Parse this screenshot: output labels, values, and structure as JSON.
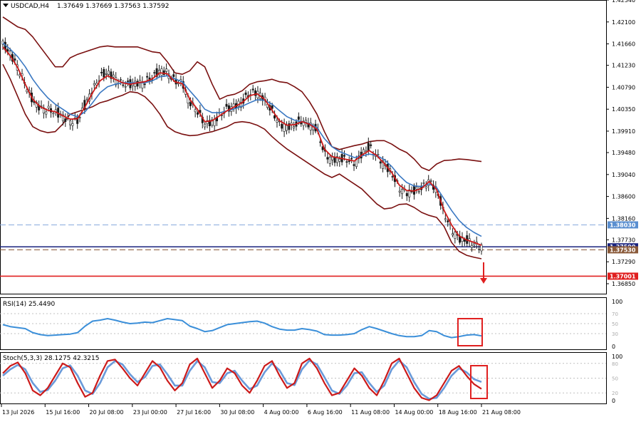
{
  "symbol_label": "USDCAD,H4",
  "ohlc_text": "1.37649 1.37669 1.37563 1.37592",
  "rsi_label": "RSI(14) 25.4490",
  "stoch_label": "Stoch(5,3,3) 28.1275 42.3215",
  "colors": {
    "background": "#ffffff",
    "candle": "#1a1a1a",
    "fast_ma": "#cc1a1a",
    "slow_ma": "#3a78c2",
    "bollinger": "#7a1010",
    "rsi_line": "#3b8fd9",
    "stoch_main": "#cc1a1a",
    "stoch_signal": "#6a9ad9",
    "current_price_line": "#1a237e",
    "support_line": "#e02020",
    "dashed_level_blue": "#88aadd",
    "dashed_level_brown": "#8a5a3a",
    "highlight_box": "#e02020"
  },
  "chart_data": {
    "type": "candlestick",
    "price_axis": {
      "ylim": [
        1.3665,
        1.4254
      ],
      "ticks": [
        "1.42540",
        "1.42100",
        "1.41660",
        "1.41230",
        "1.40790",
        "1.40350",
        "1.39910",
        "1.39480",
        "1.39040",
        "1.38600",
        "1.38160",
        "1.37730",
        "1.37290",
        "1.36850"
      ],
      "tick_values": [
        1.4254,
        1.421,
        1.4166,
        1.4123,
        1.4079,
        1.4035,
        1.3991,
        1.3948,
        1.3904,
        1.386,
        1.3816,
        1.3773,
        1.3729,
        1.3685
      ]
    },
    "price_tags": [
      {
        "text": "1.38030",
        "value": 1.3803,
        "color": "#5a8fd0"
      },
      {
        "text": "1.37590",
        "value": 1.3759,
        "color": "#1a237e"
      },
      {
        "text": "1.37530",
        "value": 1.3753,
        "color": "#8a5a3a"
      },
      {
        "text": "1.37001",
        "value": 1.37001,
        "color": "#e02020"
      }
    ],
    "horizontal_levels": [
      {
        "value": 1.3803,
        "style": "dashed",
        "color": "#88aadd"
      },
      {
        "value": 1.3759,
        "style": "solid",
        "color": "#1a237e"
      },
      {
        "value": 1.3753,
        "style": "dashed",
        "color": "#8a5a3a"
      },
      {
        "value": 1.37001,
        "style": "solid",
        "color": "#e02020"
      }
    ],
    "time_labels": [
      "13 Jul 2026",
      "15 Jul 16:00",
      "20 Jul 08:00",
      "23 Jul 00:00",
      "27 Jul 16:00",
      "30 Jul 08:00",
      "4 Aug 00:00",
      "6 Aug 16:00",
      "11 Aug 08:00",
      "14 Aug 00:00",
      "18 Aug 16:00",
      "21 Aug 08:00"
    ],
    "close_path": [
      1.4165,
      1.4145,
      1.412,
      1.4085,
      1.405,
      1.4038,
      1.4035,
      1.4028,
      1.402,
      1.4012,
      1.401,
      1.4045,
      1.4075,
      1.41,
      1.4108,
      1.4098,
      1.4085,
      1.4083,
      1.4088,
      1.409,
      1.4098,
      1.4113,
      1.411,
      1.409,
      1.4088,
      1.405,
      1.403,
      1.4005,
      1.401,
      1.4022,
      1.4035,
      1.4042,
      1.405,
      1.4065,
      1.407,
      1.4055,
      1.403,
      1.4005,
      1.4,
      1.4002,
      1.4012,
      1.4005,
      1.3995,
      1.3945,
      1.3935,
      1.3935,
      1.3933,
      1.3928,
      1.3945,
      1.3958,
      1.3942,
      1.3925,
      1.3905,
      1.3877,
      1.3868,
      1.387,
      1.3876,
      1.3893,
      1.3872,
      1.3825,
      1.3795,
      1.3775,
      1.377,
      1.3766,
      1.3759
    ],
    "bollinger_upper": [
      1.422,
      1.421,
      1.42,
      1.4195,
      1.418,
      1.416,
      1.414,
      1.412,
      1.412,
      1.4138,
      1.4145,
      1.415,
      1.4155,
      1.416,
      1.4162,
      1.416,
      1.416,
      1.416,
      1.416,
      1.4155,
      1.415,
      1.4148,
      1.413,
      1.4108,
      1.4105,
      1.4112,
      1.413,
      1.412,
      1.4085,
      1.4055,
      1.4062,
      1.4065,
      1.4072,
      1.4085,
      1.409,
      1.4092,
      1.4095,
      1.409,
      1.4088,
      1.408,
      1.407,
      1.405,
      1.4025,
      1.399,
      1.396,
      1.3954,
      1.3958,
      1.3962,
      1.3965,
      1.397,
      1.3972,
      1.3972,
      1.3965,
      1.3955,
      1.3948,
      1.3935,
      1.3918,
      1.3912,
      1.3925,
      1.3932,
      1.3933,
      1.3935,
      1.3934,
      1.3932,
      1.393
    ],
    "bollinger_lower": [
      1.4125,
      1.4095,
      1.406,
      1.4025,
      1.4,
      1.3992,
      1.3988,
      1.399,
      1.4005,
      1.4025,
      1.403,
      1.4035,
      1.404,
      1.4048,
      1.4052,
      1.4058,
      1.4063,
      1.407,
      1.4068,
      1.406,
      1.4045,
      1.4025,
      1.4,
      1.399,
      1.3985,
      1.3982,
      1.3983,
      1.3987,
      1.399,
      1.3995,
      1.4,
      1.4008,
      1.401,
      1.4008,
      1.4003,
      1.3995,
      1.398,
      1.3967,
      1.3955,
      1.3945,
      1.3935,
      1.3925,
      1.3915,
      1.3905,
      1.3898,
      1.3905,
      1.3895,
      1.3885,
      1.3875,
      1.386,
      1.3845,
      1.3835,
      1.3837,
      1.3844,
      1.3845,
      1.3838,
      1.3828,
      1.3822,
      1.3818,
      1.38,
      1.3768,
      1.375,
      1.3742,
      1.3738,
      1.3735
    ],
    "moving_average_fast": [
      1.416,
      1.4142,
      1.4118,
      1.4085,
      1.4055,
      1.404,
      1.4033,
      1.403,
      1.4022,
      1.4015,
      1.4016,
      1.404,
      1.4068,
      1.4092,
      1.4102,
      1.4095,
      1.4088,
      1.4085,
      1.4088,
      1.409,
      1.4096,
      1.4108,
      1.4106,
      1.409,
      1.4086,
      1.4055,
      1.4035,
      1.401,
      1.4012,
      1.4022,
      1.4032,
      1.404,
      1.4048,
      1.4062,
      1.4066,
      1.4055,
      1.4033,
      1.4012,
      1.4003,
      1.4004,
      1.401,
      1.4005,
      1.3995,
      1.3955,
      1.394,
      1.3937,
      1.3934,
      1.3931,
      1.3943,
      1.3952,
      1.3942,
      1.3926,
      1.3908,
      1.3883,
      1.3872,
      1.3871,
      1.3876,
      1.389,
      1.3874,
      1.3832,
      1.3803,
      1.3781,
      1.3773,
      1.3768,
      1.3762
    ],
    "moving_average_slow": [
      1.4168,
      1.4155,
      1.414,
      1.412,
      1.4095,
      1.4075,
      1.4058,
      1.4045,
      1.4035,
      1.4025,
      1.402,
      1.403,
      1.4048,
      1.4068,
      1.408,
      1.4085,
      1.4088,
      1.4088,
      1.4088,
      1.4088,
      1.4092,
      1.41,
      1.4102,
      1.4096,
      1.409,
      1.4072,
      1.4055,
      1.4035,
      1.4028,
      1.4028,
      1.4032,
      1.4036,
      1.4041,
      1.4048,
      1.4054,
      1.4053,
      1.4045,
      1.4032,
      1.402,
      1.4013,
      1.401,
      1.4006,
      1.3998,
      1.3976,
      1.396,
      1.395,
      1.3944,
      1.3938,
      1.3941,
      1.3945,
      1.3942,
      1.3934,
      1.392,
      1.3902,
      1.3888,
      1.3881,
      1.388,
      1.3885,
      1.3878,
      1.3855,
      1.3832,
      1.3812,
      1.3798,
      1.3788,
      1.378
    ],
    "rsi": {
      "label": "RSI(14)",
      "last_value": 25.449,
      "levels": [
        70,
        50,
        30
      ],
      "axis_ticks": [
        "100",
        "0"
      ],
      "values": [
        48,
        44,
        42,
        40,
        32,
        28,
        26,
        27,
        28,
        29,
        32,
        45,
        55,
        57,
        60,
        57,
        53,
        50,
        51,
        53,
        52,
        56,
        60,
        58,
        56,
        45,
        40,
        34,
        36,
        42,
        48,
        50,
        52,
        54,
        55,
        51,
        44,
        39,
        37,
        37,
        40,
        38,
        35,
        28,
        27,
        27,
        28,
        30,
        38,
        44,
        40,
        35,
        30,
        26,
        24,
        24,
        26,
        36,
        34,
        26,
        22,
        24,
        27,
        28,
        25.4
      ]
    },
    "stochastic": {
      "label": "Stoch(5,3,3)",
      "main_value": 28.1275,
      "signal_value": 42.3215,
      "levels": [
        80,
        50,
        20
      ],
      "axis_ticks": [
        "100",
        "0"
      ],
      "main": [
        60,
        75,
        82,
        60,
        25,
        15,
        30,
        55,
        80,
        72,
        40,
        12,
        20,
        55,
        85,
        88,
        70,
        50,
        35,
        60,
        85,
        72,
        45,
        25,
        40,
        78,
        90,
        60,
        30,
        45,
        70,
        60,
        35,
        20,
        45,
        75,
        85,
        55,
        30,
        40,
        80,
        90,
        70,
        40,
        15,
        20,
        45,
        70,
        55,
        30,
        15,
        45,
        80,
        90,
        60,
        30,
        10,
        5,
        15,
        40,
        65,
        75,
        55,
        38,
        28.1
      ],
      "signal": [
        55,
        68,
        77,
        68,
        40,
        22,
        26,
        45,
        70,
        76,
        55,
        25,
        18,
        40,
        72,
        85,
        78,
        58,
        42,
        52,
        75,
        78,
        58,
        35,
        35,
        65,
        85,
        72,
        42,
        40,
        60,
        65,
        45,
        28,
        35,
        62,
        80,
        66,
        40,
        36,
        68,
        86,
        78,
        52,
        25,
        18,
        35,
        60,
        62,
        40,
        22,
        35,
        68,
        86,
        72,
        42,
        18,
        8,
        10,
        30,
        55,
        70,
        62,
        48,
        42.3
      ]
    }
  }
}
